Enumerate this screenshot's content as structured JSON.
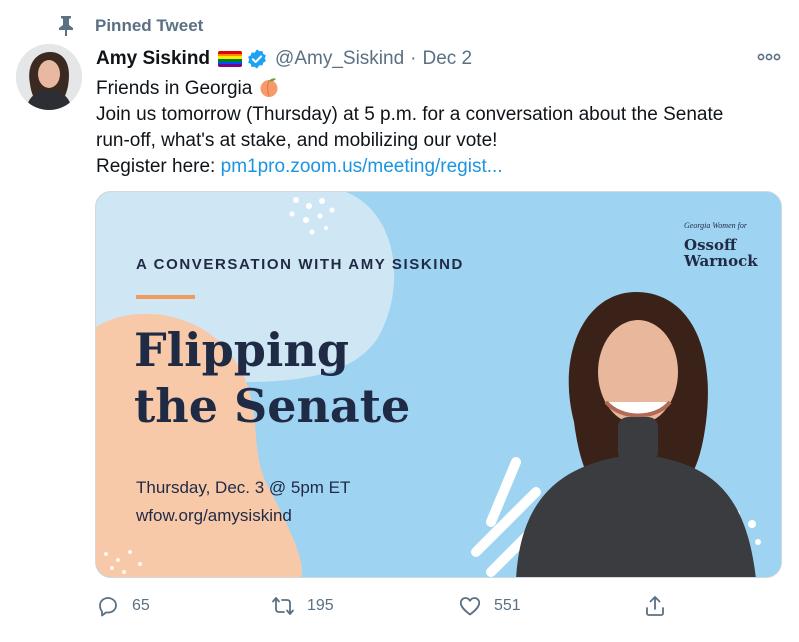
{
  "pinned": {
    "label": "Pinned Tweet"
  },
  "author": {
    "display_name": "Amy Siskind",
    "handle": "@Amy_Siskind",
    "date": "Dec 2",
    "separator": "·"
  },
  "tweet": {
    "line1": "Friends in Georgia",
    "line2": "Join us tomorrow (Thursday) at 5 p.m. for a conversation about the Senate",
    "line3": "run-off, what's at stake, and mobilizing our vote!",
    "register_prefix": "Register here: ",
    "link": "pm1pro.zoom.us/meeting/regist..."
  },
  "card": {
    "kicker": "A CONVERSATION WITH AMY SISKIND",
    "title_line1": "Flipping",
    "title_line2": "the Senate",
    "date_text": "Thursday, Dec. 3 @ 5pm ET",
    "url_text": "wfow.org/amysiskind",
    "logo_small": "Georgia Women for",
    "logo_line1": "Ossoff",
    "logo_line2": "Warnock",
    "colors": {
      "bg": "#9fd3f2",
      "pale": "#cfe6f5",
      "peach": "#f8c9a8",
      "navy": "#1f2a44",
      "accent": "#f09a5e"
    }
  },
  "actions": {
    "reply_count": "65",
    "retweet_count": "195",
    "like_count": "551"
  },
  "icons": [
    "pin-icon",
    "verified-badge-icon",
    "rainbow-flag-icon",
    "peach-emoji-icon",
    "more-icon",
    "reply-icon",
    "retweet-icon",
    "like-icon",
    "share-icon"
  ],
  "colors": {
    "secondary_text": "#5b7083",
    "link": "#1b95e0",
    "verified": "#1da1f2"
  }
}
